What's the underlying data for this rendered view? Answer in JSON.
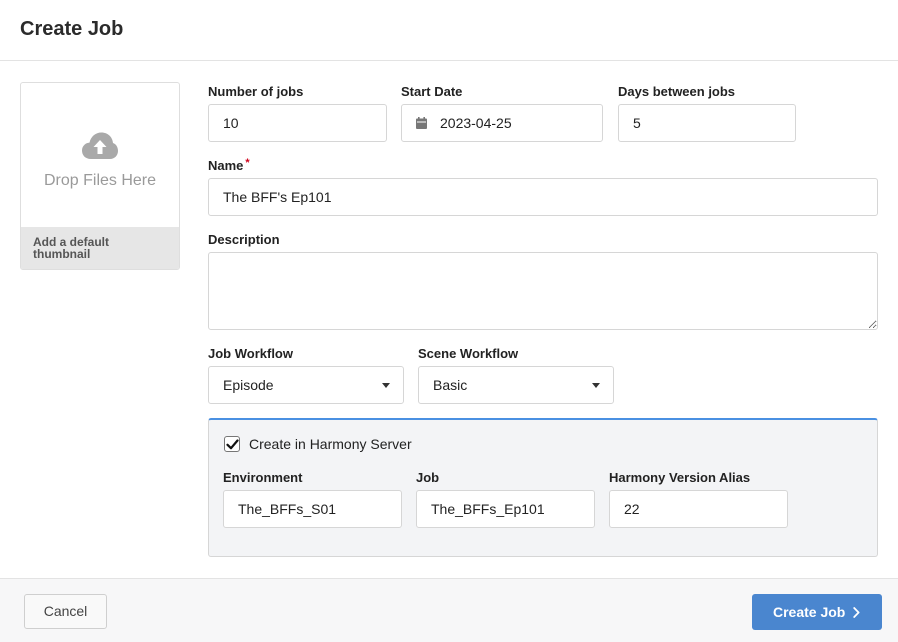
{
  "header": {
    "title": "Create Job"
  },
  "thumbnail": {
    "drop_text": "Drop Files Here",
    "default_label": "Add a default thumbnail",
    "icon": "cloud-upload-icon"
  },
  "form": {
    "number_of_jobs": {
      "label": "Number of jobs",
      "value": "10"
    },
    "start_date": {
      "label": "Start Date",
      "value": "2023-04-25",
      "icon": "calendar-icon"
    },
    "days_between": {
      "label": "Days between jobs",
      "value": "5"
    },
    "name": {
      "label": "Name",
      "required_mark": "*",
      "value": "The BFF's Ep101"
    },
    "description": {
      "label": "Description",
      "value": ""
    },
    "job_workflow": {
      "label": "Job Workflow",
      "value": "Episode"
    },
    "scene_workflow": {
      "label": "Scene Workflow",
      "value": "Basic"
    }
  },
  "harmony": {
    "checkbox_label": "Create in Harmony Server",
    "checked": true,
    "environment": {
      "label": "Environment",
      "value": "The_BFFs_S01"
    },
    "job": {
      "label": "Job",
      "value": "The_BFFs_Ep101"
    },
    "version_alias": {
      "label": "Harmony Version Alias",
      "value": "22"
    }
  },
  "footer": {
    "cancel_label": "Cancel",
    "create_label": "Create Job"
  },
  "colors": {
    "accent": "#4a86cf",
    "harmony_border": "#4a90e2",
    "required": "#d0021b"
  }
}
